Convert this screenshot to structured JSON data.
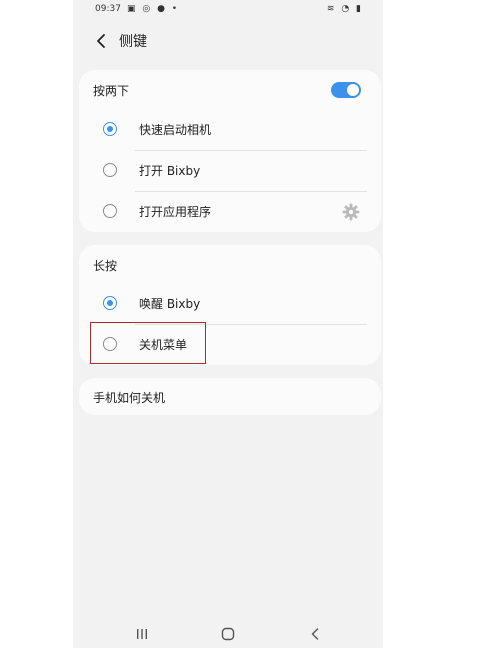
{
  "status_bar": {
    "time": "09:37",
    "left_icons": "▣ ◎ ● •",
    "right_icons": "≋ ◔ ▮"
  },
  "header": {
    "title": "侧键"
  },
  "double_press": {
    "label": "按两下",
    "enabled": true,
    "options": [
      {
        "label": "快速启动相机",
        "selected": true
      },
      {
        "label": "打开 Bixby",
        "selected": false
      },
      {
        "label": "打开应用程序",
        "selected": false
      }
    ]
  },
  "long_press": {
    "label": "长按",
    "options": [
      {
        "label": "唤醒 Bixby",
        "selected": true
      },
      {
        "label": "关机菜单",
        "selected": false
      }
    ]
  },
  "help_link": {
    "label": "手机如何关机"
  },
  "colors": {
    "accent": "#3e91ea",
    "highlight": "#b02a2a"
  },
  "icons": {
    "back": "chevron-left-icon",
    "settings": "gear-icon",
    "nav_recent": "recent-apps-icon",
    "nav_home": "home-icon",
    "nav_back": "back-icon"
  }
}
